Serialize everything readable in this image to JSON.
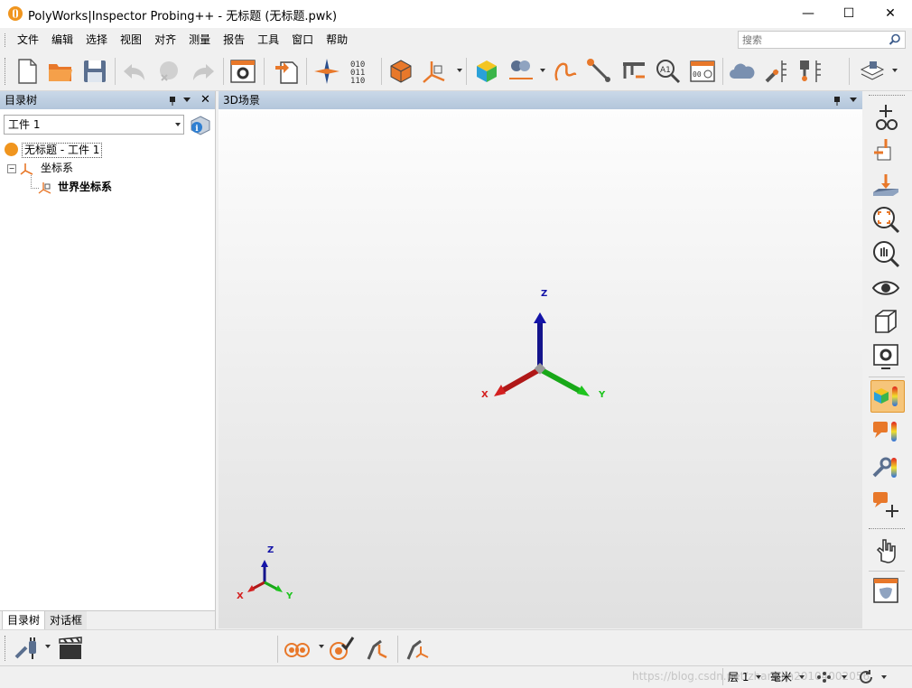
{
  "window": {
    "title": "PolyWorks|Inspector Probing++ - 无标题 (无标题.pwk)",
    "minimize": "—",
    "maximize": "☐",
    "close": "✕"
  },
  "menu": [
    "文件",
    "编辑",
    "选择",
    "视图",
    "对齐",
    "测量",
    "报告",
    "工具",
    "窗口",
    "帮助"
  ],
  "search": {
    "placeholder": "搜索"
  },
  "left_panel": {
    "title": "目录树",
    "piece_selector": "工件 1",
    "tree": {
      "root": "无标题 - 工件 1",
      "child": "坐标系",
      "grandchild": "世界坐标系"
    },
    "tabs": [
      "目录树",
      "对话框"
    ]
  },
  "scene": {
    "title": "3D场景",
    "axis_labels": {
      "x": "X",
      "y": "Y",
      "z": "Z"
    }
  },
  "status": {
    "layer": "层 1",
    "unit": "毫米",
    "watermark": "https://blog.csdn.net/zhangjin20104002056"
  },
  "colors": {
    "accent_orange": "#f07c21",
    "axis_x": "#d42020",
    "axis_y": "#1ec41e",
    "axis_z": "#1414a8",
    "panel_header": "#b9cadc"
  }
}
